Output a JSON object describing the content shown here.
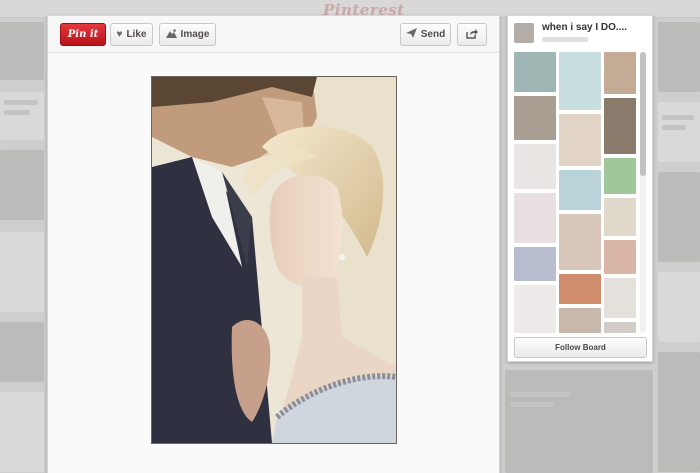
{
  "site": {
    "logo_text": "Pinterest"
  },
  "toolbar": {
    "pinit_label": "Pin it",
    "like_label": "Like",
    "image_label": "Image",
    "send_label": "Send"
  },
  "icons": {
    "like": "heart-icon",
    "image": "image-icon",
    "send": "paper-plane-icon",
    "share": "share-arrow-icon"
  },
  "board": {
    "title": "when i say I DO....",
    "follow_label": "Follow Board"
  },
  "colors": {
    "pinit_red": "#cb2027",
    "overlay_gray": "#cfcdcd",
    "panel_bg": "#fafafa"
  }
}
